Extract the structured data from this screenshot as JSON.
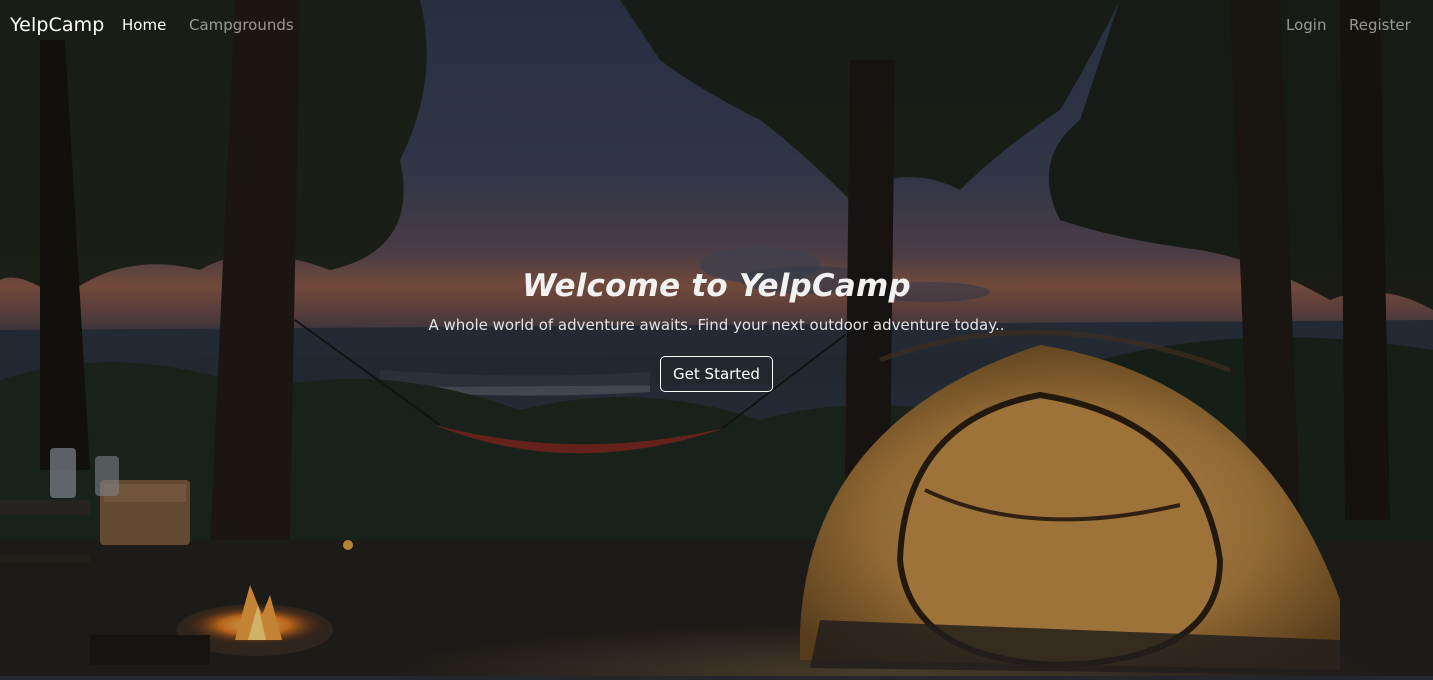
{
  "navbar": {
    "brand": "YelpCamp",
    "links": {
      "home": "Home",
      "campgrounds": "Campgrounds",
      "login": "Login",
      "register": "Register"
    }
  },
  "hero": {
    "title": "Welcome to YelpCamp",
    "subtitle": "A whole world of adventure awaits. Find your next outdoor adventure today..",
    "cta_label": "Get Started"
  },
  "colors": {
    "text_primary": "#ffffff",
    "text_muted": "rgba(255,255,255,0.55)",
    "background": "#1a1c22"
  }
}
